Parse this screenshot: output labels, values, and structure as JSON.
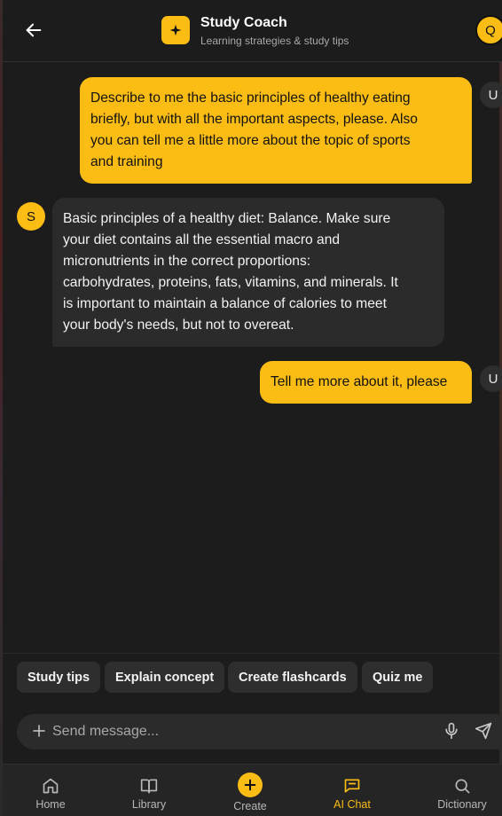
{
  "header": {
    "title": "Study Coach",
    "subtitle": "Learning strategies & study tips",
    "user_avatar": "Q",
    "logo_icon": "sparkle-icon"
  },
  "messages": [
    {
      "role": "user",
      "avatar": "U",
      "lines": [
        "Describe to me the basic principles of healthy eating",
        "briefly, but with all the important aspects, please. Also",
        "you can tell me a little more about the topic of sports",
        "and training"
      ]
    },
    {
      "role": "bot",
      "avatar": "S",
      "lines": [
        "Basic principles of a healthy diet: Balance. Make sure",
        "your diet contains all the essential macro and",
        "micronutrients in the correct proportions:",
        "carbohydrates, proteins, fats, vitamins, and minerals. It",
        "is important to maintain a balance of calories to meet",
        "your body's needs, but not to overeat."
      ]
    },
    {
      "role": "user",
      "avatar": "U",
      "lines": [
        "Tell me more about it, please"
      ]
    }
  ],
  "suggestions": [
    "Study tips",
    "Explain concept",
    "Create flashcards",
    "Quiz me"
  ],
  "composer": {
    "placeholder": "Send message...",
    "value": ""
  },
  "nav": [
    {
      "label": "Home",
      "icon": "home-icon",
      "active": false
    },
    {
      "label": "Library",
      "icon": "book-icon",
      "active": false
    },
    {
      "label": "Create",
      "icon": "plus-icon",
      "active": false
    },
    {
      "label": "AI Chat",
      "icon": "chat-icon",
      "active": true
    },
    {
      "label": "Dictionary",
      "icon": "search-icon",
      "active": false
    }
  ],
  "colors": {
    "accent": "#fbbd14",
    "background": "#1c1c1c",
    "bot_bubble": "#2b2b2b",
    "chip": "#2e2e2e",
    "nav_background": "#252525"
  }
}
